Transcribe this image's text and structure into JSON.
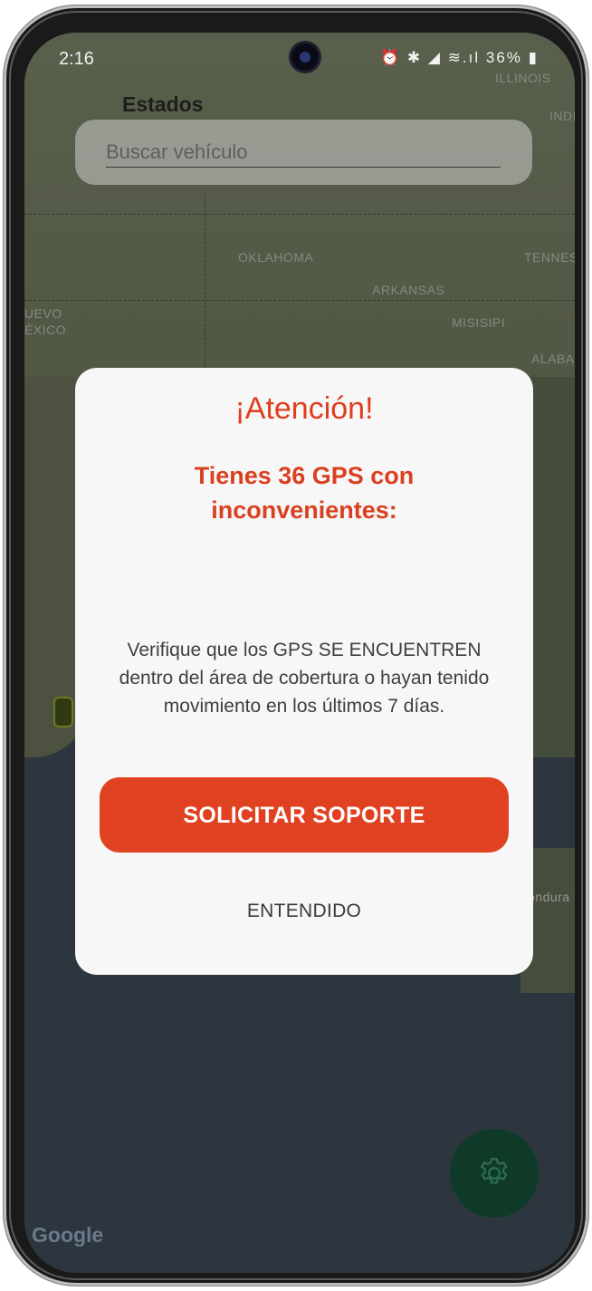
{
  "status_bar": {
    "time": "2:16",
    "icons": "⏰ ✱ ◢ ≋.ıl",
    "battery": "36%"
  },
  "header": {
    "title": "Estados"
  },
  "search": {
    "placeholder": "Buscar vehículo",
    "value": ""
  },
  "map": {
    "labels": {
      "illinois": "ILLINOIS",
      "indiana": "INDIA",
      "oklahoma": "OKLAHOMA",
      "tennessee": "TENNESS",
      "arkansas": "ARKANSAS",
      "nuevo_mexico_1": "UEVO",
      "nuevo_mexico_2": "ÉXICO",
      "misisipi": "MISISIPI",
      "alabama": "ALABAN",
      "honduras": "ondura"
    },
    "provider": "Google"
  },
  "dialog": {
    "title": "¡Atención!",
    "subtitle": "Tienes  36  GPS con inconvenientes:",
    "body": "Verifique que los GPS SE ENCUENTREN dentro del área de cobertura o hayan tenido movimiento en los últimos 7 días.",
    "primary_button": "SOLICITAR SOPORTE",
    "secondary_button": "ENTENDIDO"
  },
  "colors": {
    "accent": "#e04221",
    "title": "#df3d1c",
    "fab": "#0e3a27",
    "dialog_bg": "#f7f7f7"
  },
  "icons": {
    "fab": "gear-icon"
  }
}
